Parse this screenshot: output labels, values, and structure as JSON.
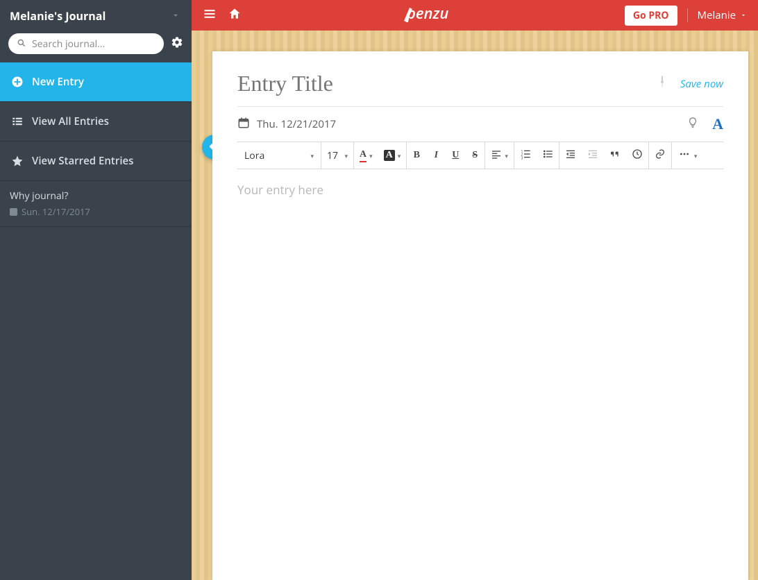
{
  "colors": {
    "accent": "#23b5ea",
    "brand": "#dd4039"
  },
  "sidebar": {
    "journal_title": "Melanie's Journal",
    "search_placeholder": "Search journal...",
    "nav": {
      "new_entry": "New Entry",
      "view_all": "View All Entries",
      "view_starred": "View Starred Entries"
    },
    "entries": [
      {
        "title": "Why journal?",
        "date": "Sun. 12/17/2017"
      }
    ]
  },
  "topbar": {
    "go_pro": "Go PRO",
    "user_name": "Melanie",
    "logo_text": "penzu"
  },
  "entry": {
    "title_placeholder": "Entry Title",
    "date": "Thu. 12/21/2017",
    "save_now": "Save now",
    "body_placeholder": "Your entry here"
  },
  "toolbar": {
    "font_family": "Lora",
    "font_size": "17"
  }
}
